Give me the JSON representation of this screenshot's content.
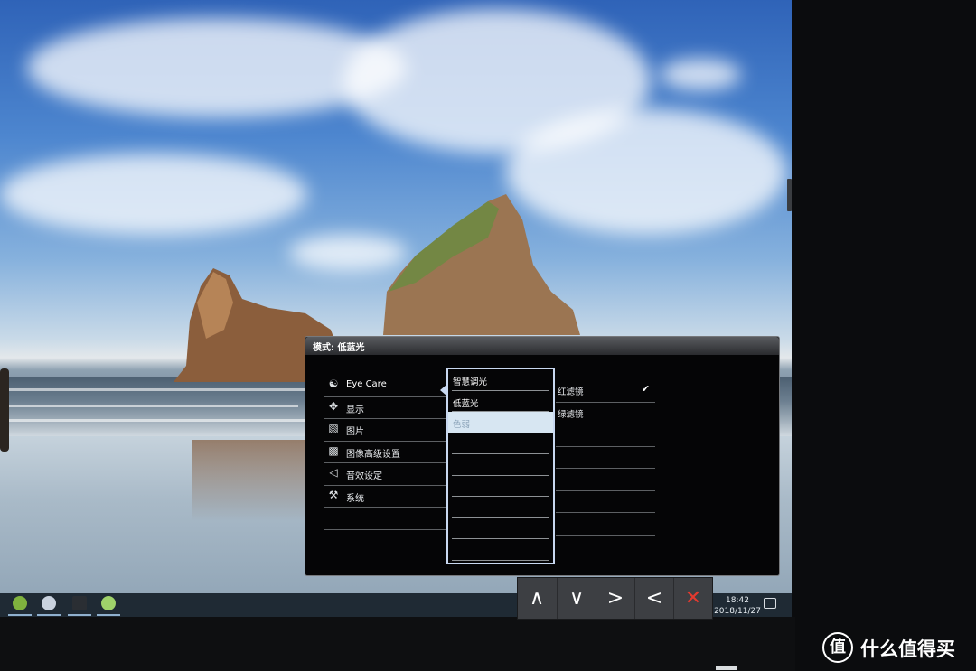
{
  "osd": {
    "title": "模式: 低蓝光",
    "menu": [
      {
        "icon": "eye-care-icon",
        "glyph": "☯",
        "label": "Eye Care",
        "active": true
      },
      {
        "icon": "display-icon",
        "glyph": "✥",
        "label": "显示"
      },
      {
        "icon": "picture-icon",
        "glyph": "▧",
        "label": "图片"
      },
      {
        "icon": "picture-advanced-icon",
        "glyph": "▩",
        "label": "图像高级设置"
      },
      {
        "icon": "speaker-icon",
        "glyph": "◁",
        "label": "音效设定"
      },
      {
        "icon": "wrench-icon",
        "glyph": "⚒",
        "label": "系统"
      },
      {
        "icon": "",
        "glyph": "",
        "label": ""
      }
    ],
    "submenu": [
      "智慧调光",
      "低蓝光",
      "色弱",
      "",
      "",
      "",
      "",
      "",
      ""
    ],
    "submenu_highlight_index": 2,
    "options": [
      {
        "label": "红滤镜",
        "checked": true
      },
      {
        "label": "绿滤镜",
        "checked": false
      },
      {
        "label": "",
        "checked": false
      },
      {
        "label": "",
        "checked": false
      },
      {
        "label": "",
        "checked": false
      },
      {
        "label": "",
        "checked": false
      },
      {
        "label": "",
        "checked": false
      }
    ],
    "checkmark": "✔"
  },
  "keybar": {
    "up": "∧",
    "down": "∨",
    "right": ">",
    "left": "<",
    "close": "✕"
  },
  "taskbar": {
    "time": "18:42",
    "date": "2018/11/27"
  },
  "watermark": {
    "logo": "值",
    "text": "什么值得买"
  },
  "colors": {
    "accent": "#c8d8f0",
    "close": "#e23a2f",
    "highlight": "#d7e6f2"
  }
}
